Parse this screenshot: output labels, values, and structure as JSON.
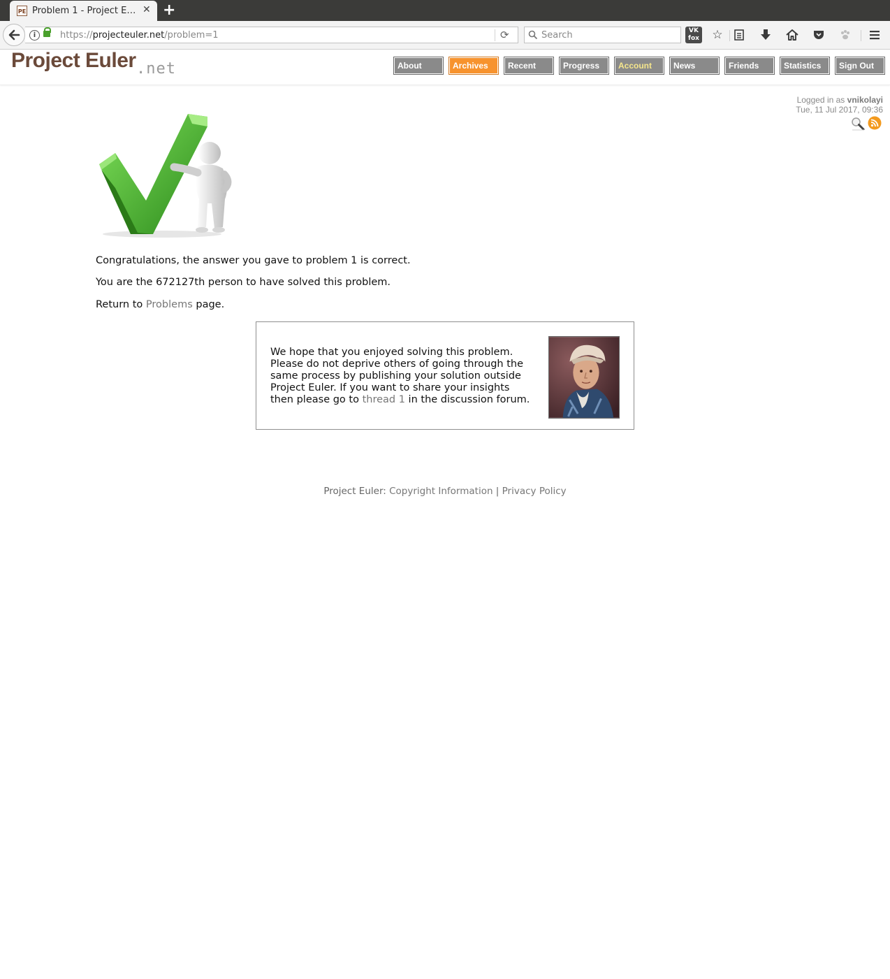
{
  "browser": {
    "tab_title": "Problem 1 - Project E…",
    "tab_favicon_text": "PE",
    "url_scheme": "https://",
    "url_host": "projecteuler.net",
    "url_path": "/problem=1",
    "search_placeholder": "Search",
    "vkfox_label_1": "VK",
    "vkfox_label_2": "fox"
  },
  "site": {
    "logo_main": "Project Euler",
    "logo_net": ".net",
    "nav": [
      {
        "label": "About",
        "state": "normal"
      },
      {
        "label": "Archives",
        "state": "active"
      },
      {
        "label": "Recent",
        "state": "normal"
      },
      {
        "label": "Progress",
        "state": "normal"
      },
      {
        "label": "Account",
        "state": "highlight"
      },
      {
        "label": "News",
        "state": "normal"
      },
      {
        "label": "Friends",
        "state": "normal"
      },
      {
        "label": "Statistics",
        "state": "normal"
      },
      {
        "label": "Sign Out",
        "state": "normal"
      }
    ],
    "colors": {
      "active_nav": "#f7932e",
      "nav": "#8a8a8a",
      "logo": "#6b4a3a"
    }
  },
  "user": {
    "logged_in_prefix": "Logged in as",
    "username": "vnikolayi",
    "datetime": "Tue, 11 Jul 2017, 09:36"
  },
  "content": {
    "congrats": "Congratulations, the answer you gave to problem 1 is correct.",
    "solver_prefix": "You are the ",
    "solver_rank": "672127th",
    "solver_suffix": " person to have solved this problem.",
    "return_prefix": "Return to ",
    "return_link": "Problems",
    "return_suffix": " page.",
    "notice_text": "We hope that you enjoyed solving this problem. Please do not deprive others of going through the same process by publishing your solution outside Project Euler. If you want to share your insights then please go to ",
    "notice_link": "thread 1",
    "notice_suffix": " in the discussion forum."
  },
  "footer": {
    "prefix": "Project Euler: ",
    "copyright": "Copyright Information",
    "separator": " | ",
    "privacy": "Privacy Policy"
  }
}
